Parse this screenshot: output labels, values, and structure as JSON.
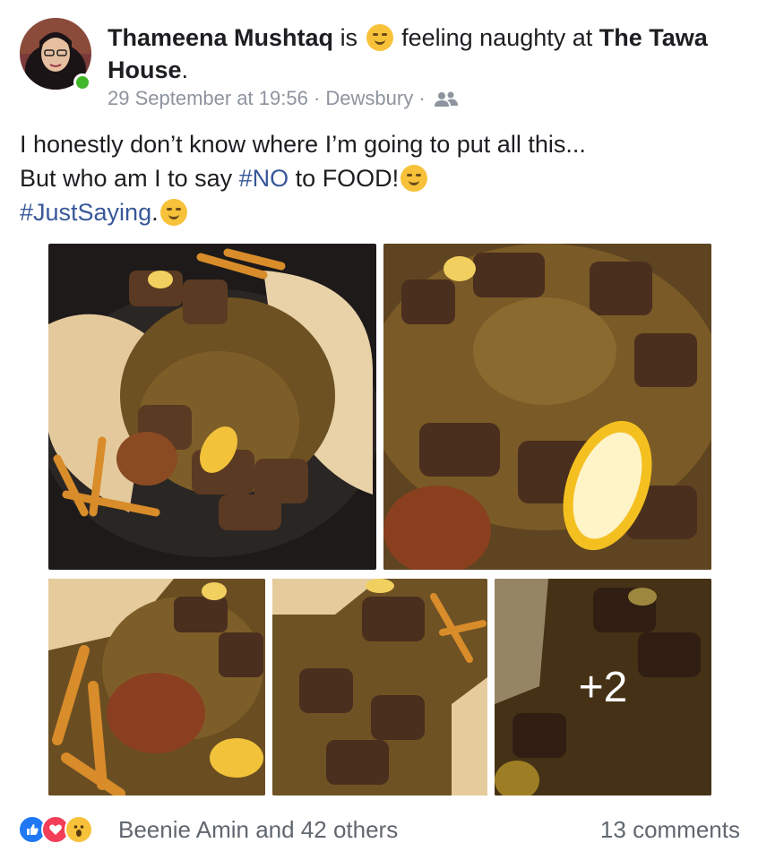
{
  "post": {
    "author": "Thameena Mushtaq",
    "is_text": "is",
    "feeling_text": "feeling naughty at",
    "place": "The Tawa House",
    "place_suffix": ".",
    "timestamp": "29 September at 19:56",
    "separator": "·",
    "location": "Dewsbury",
    "privacy_icon": "friends-icon",
    "text_line1": "I honestly don’t know where I’m going to put all this...",
    "text_line2_prefix": "But who am I to say",
    "hashtag_no": "#NO",
    "text_line2_suffix": "to FOOD!",
    "hashtag_just": "#JustSaying",
    "hashtag_just_suffix": "."
  },
  "photos": {
    "count": 5,
    "more_overlay": "+2"
  },
  "footer": {
    "reaction_icons": [
      "like-icon",
      "love-icon",
      "wow-icon"
    ],
    "likes_text": "Beenie Amin and 42 others",
    "comments_text": "13 comments"
  },
  "colors": {
    "hashtag": "#385898",
    "online": "#42b72a",
    "like": "#2078f4",
    "love": "#f33e58",
    "wow": "#f7c23a"
  }
}
